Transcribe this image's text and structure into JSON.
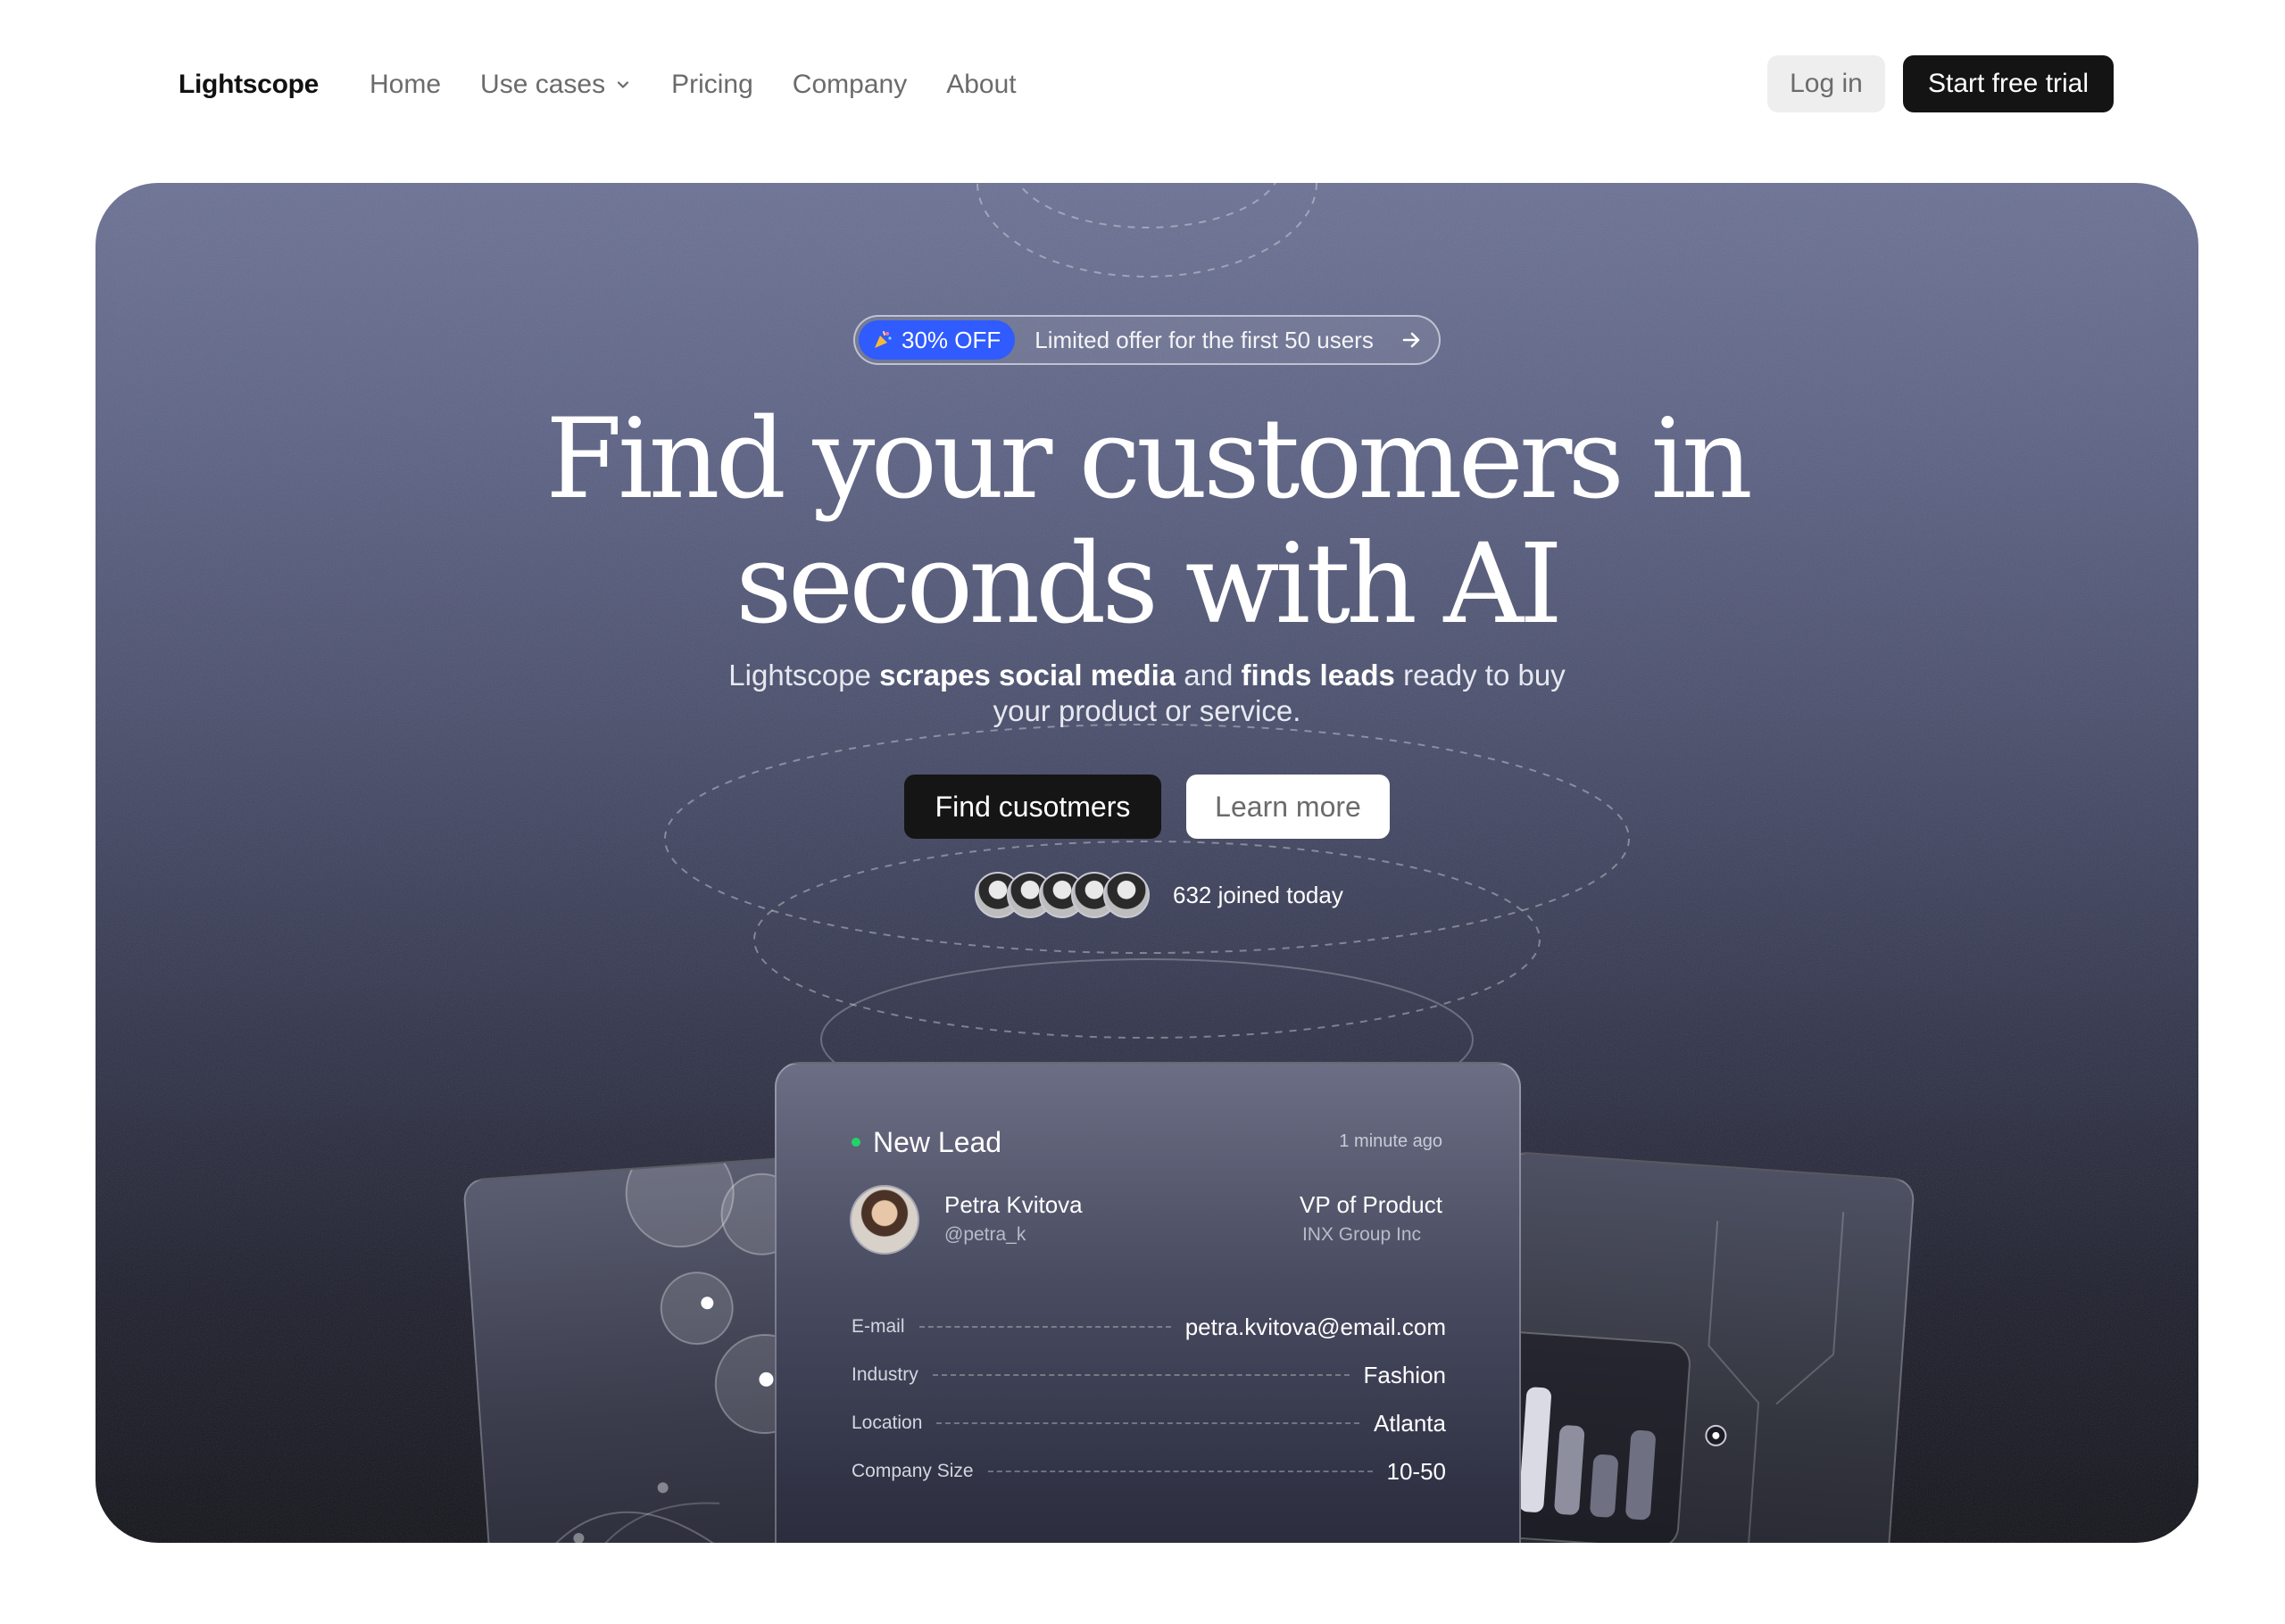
{
  "nav": {
    "logo": "Lightscope",
    "links": [
      "Home",
      "Use cases",
      "Pricing",
      "Company",
      "About"
    ],
    "login": "Log in",
    "trial": "Start free trial"
  },
  "hero": {
    "promo_badge": "30% OFF",
    "promo_text": "Limited offer for the first 50 users",
    "headline_line1": "Find your customers in",
    "headline_line2": "seconds with AI",
    "sub_pre": "Lightscope ",
    "sub_bold1": "scrapes social media",
    "sub_mid": " and ",
    "sub_bold2": "finds leads",
    "sub_post1": " ready to buy",
    "sub_post2": "your product or service.",
    "primary_cta": "Find cusotmers",
    "secondary_cta": "Learn more",
    "joined": "632 joined today"
  },
  "lead_card": {
    "title": "New Lead",
    "time": "1 minute ago",
    "name": "Petra Kvitova",
    "handle": "@petra_k",
    "role": "VP of Product",
    "company": "INX Group Inc",
    "fields": [
      {
        "label": "E-mail",
        "value": "petra.kvitova@email.com"
      },
      {
        "label": "Industry",
        "value": "Fashion"
      },
      {
        "label": "Location",
        "value": "Atlanta"
      },
      {
        "label": "Company Size",
        "value": "10-50"
      }
    ]
  },
  "colors": {
    "accent": "#2f5bff",
    "dark_button": "#141414",
    "status_green": "#22d36a"
  }
}
